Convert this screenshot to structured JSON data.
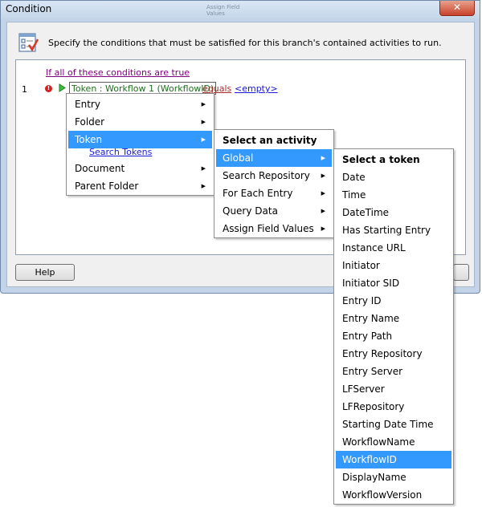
{
  "window": {
    "title": "Condition",
    "ghost_text": [
      "Assign Field",
      "Values"
    ],
    "close_label": "✕"
  },
  "instruction": "Specify the conditions that must be satisfied for this branch's contained activities to run.",
  "condition_editor": {
    "group_link": "If all of these conditions are true",
    "row": {
      "number": "1",
      "error_glyph": "!",
      "token_field": "Token : Workflow 1 (WorkflowID)",
      "operator": "equals",
      "value": "<empty>"
    }
  },
  "buttons": {
    "help": "Help"
  },
  "menu_main": {
    "items": [
      "Entry",
      "Folder",
      "Token",
      "Document",
      "Parent Folder"
    ],
    "highlighted": "Token",
    "search_link": "Search Tokens"
  },
  "menu_activity": {
    "header": "Select an activity",
    "items": [
      "Global",
      "Search Repository",
      "For Each Entry",
      "Query Data",
      "Assign Field Values"
    ],
    "highlighted": "Global"
  },
  "menu_token": {
    "header": "Select a token",
    "items": [
      "Date",
      "Time",
      "DateTime",
      "Has Starting Entry",
      "Instance URL",
      "Initiator",
      "Initiator SID",
      "Entry ID",
      "Entry Name",
      "Entry Path",
      "Entry Repository",
      "Entry Server",
      "LFServer",
      "LFRepository",
      "Starting Date Time",
      "WorkflowName",
      "WorkflowID",
      "DisplayName",
      "WorkflowVersion"
    ],
    "highlighted": "WorkflowID"
  },
  "icons": {
    "arrow": "▶",
    "condition_icon": "checklist-icon",
    "play": "play-icon",
    "error": "error-icon"
  },
  "colors": {
    "highlight": "#3399ff",
    "link_purple": "#800080",
    "link_blue": "#1a1ad6",
    "operator_red": "#a52a2a",
    "token_green": "#1e6e1e"
  }
}
